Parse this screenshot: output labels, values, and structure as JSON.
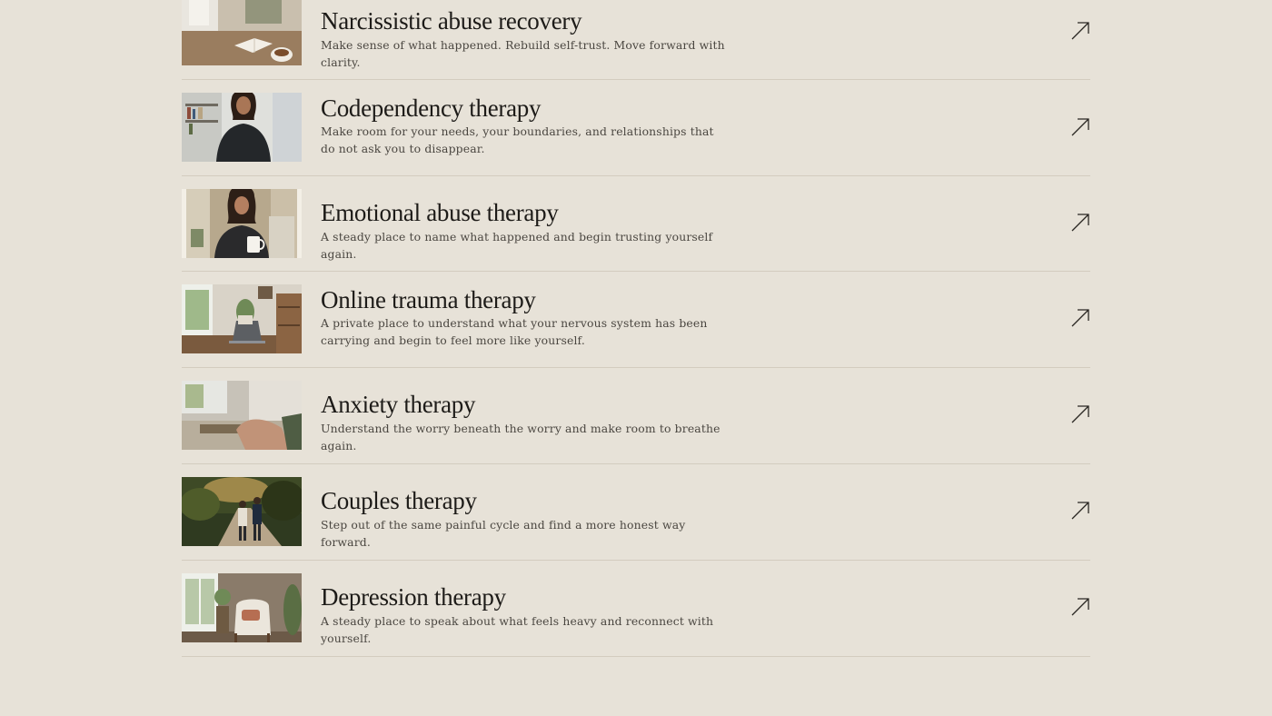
{
  "services": [
    {
      "title": "Narcissistic abuse recovery",
      "description": "Make sense of what happened. Rebuild self-trust. Move forward with clarity.",
      "image": "open-book-coffee-photo",
      "icon": "arrow-up-right-icon"
    },
    {
      "title": "Codependency therapy",
      "description": "Make room for your needs, your boundaries, and relationships that do not ask you to disappear.",
      "image": "smiling-woman-bookshelf-photo",
      "icon": "arrow-up-right-icon"
    },
    {
      "title": "Emotional abuse therapy",
      "description": "A steady place to name what happened and begin trusting yourself again.",
      "image": "woman-with-mug-photo",
      "icon": "arrow-up-right-icon"
    },
    {
      "title": "Online trauma therapy",
      "description": "A private place to understand what your nervous system has been carrying and begin to feel more like yourself.",
      "image": "laptop-desk-room-photo",
      "icon": "arrow-up-right-icon"
    },
    {
      "title": "Anxiety therapy",
      "description": "Understand the worry beneath the worry and make room to breathe again.",
      "image": "hands-on-blanket-photo",
      "icon": "arrow-up-right-icon"
    },
    {
      "title": "Couples therapy",
      "description": "Step out of the same painful cycle and find a more honest way forward.",
      "image": "couple-walking-path-photo",
      "icon": "arrow-up-right-icon"
    },
    {
      "title": "Depression therapy",
      "description": "A steady place to speak about what feels heavy and reconnect with yourself.",
      "image": "armchair-window-photo",
      "icon": "arrow-up-right-icon"
    }
  ],
  "colors": {
    "background": "#e7e2d8",
    "divider": "#d3ccbf",
    "title": "#1d1b18",
    "description": "#4a4640"
  }
}
